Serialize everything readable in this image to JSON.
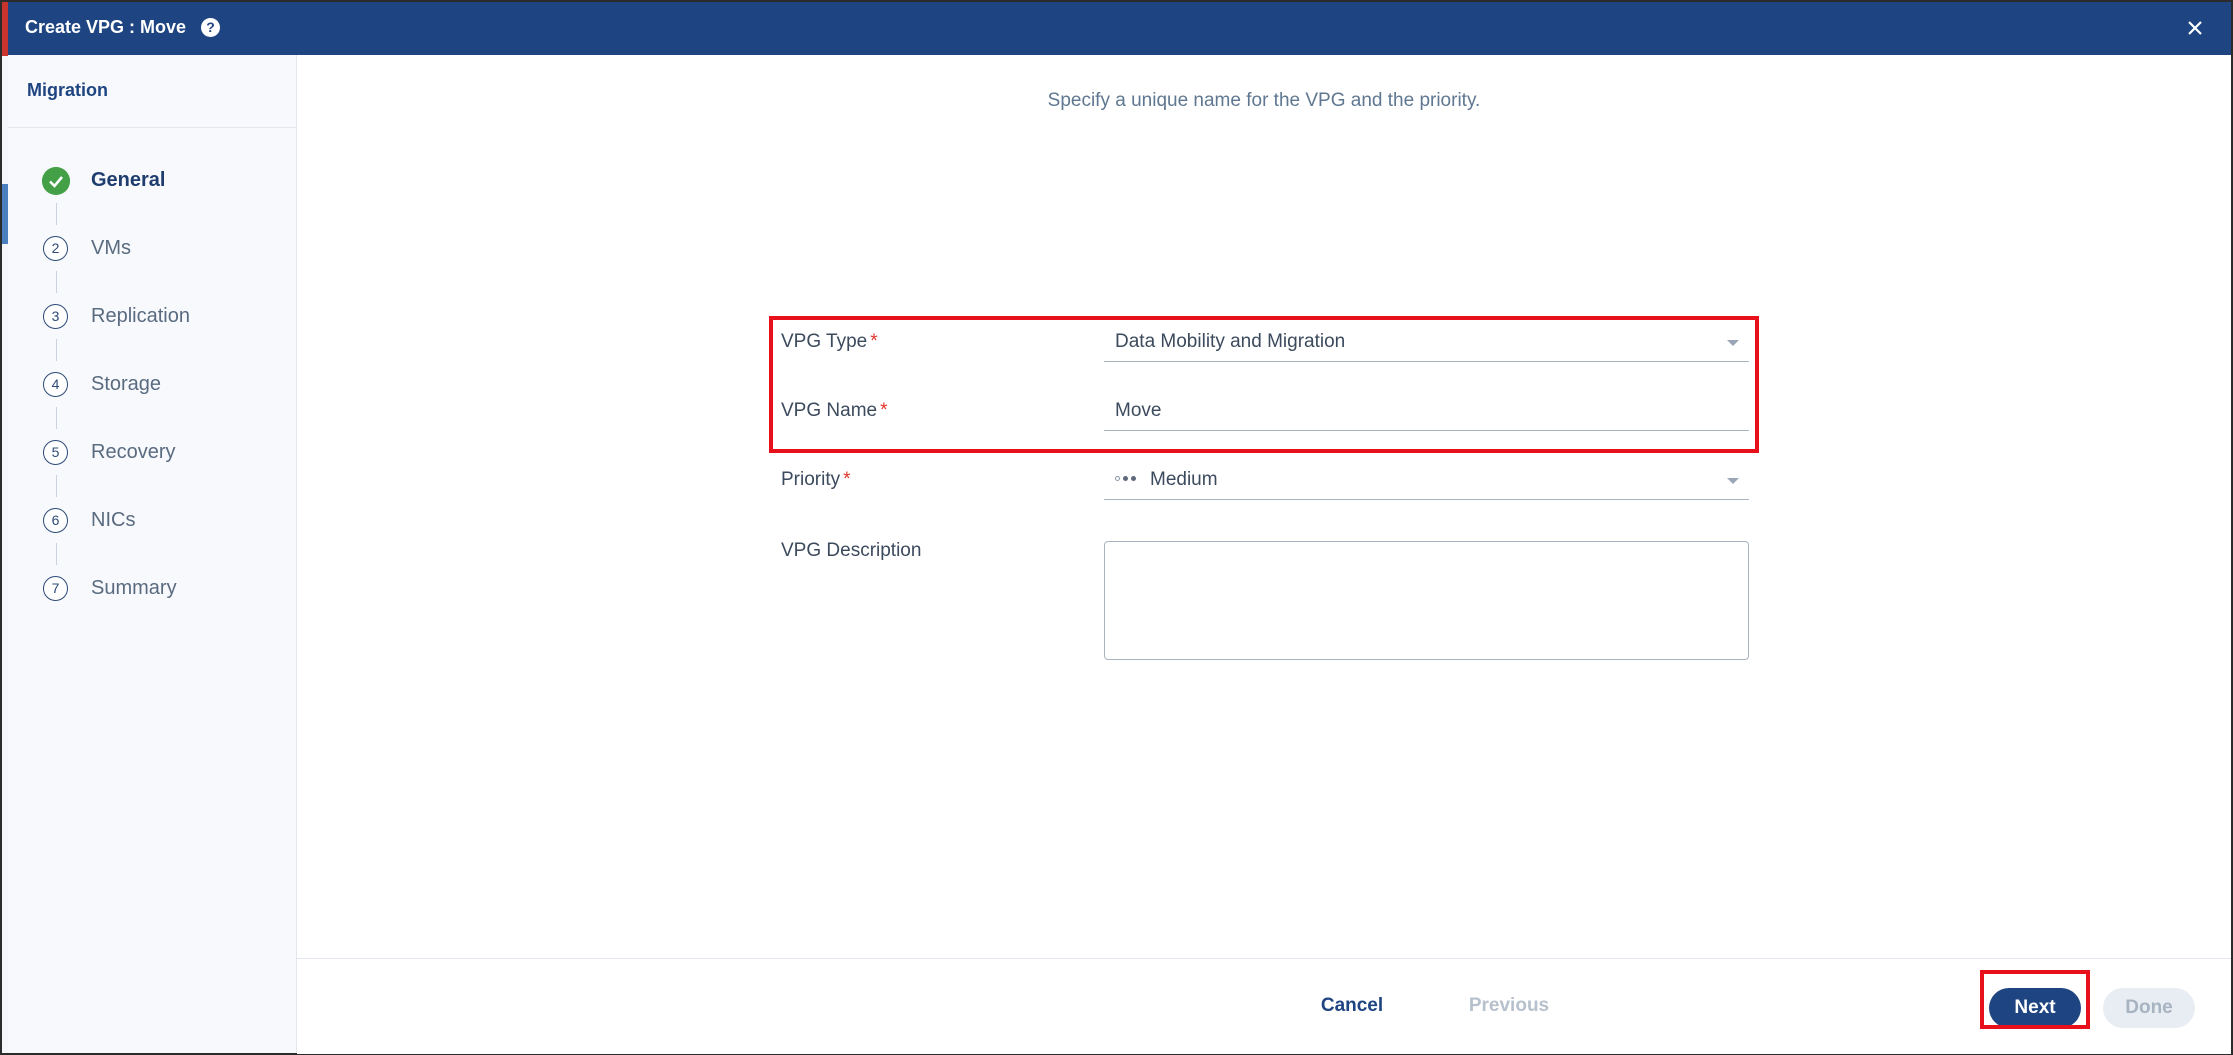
{
  "dialog": {
    "title": "Create VPG : Move",
    "help_icon": "help-icon",
    "help_glyph": "?",
    "close_icon": "close-icon"
  },
  "sidebar": {
    "title": "Migration",
    "steps": [
      {
        "number": "1",
        "label": "General",
        "state": "completed"
      },
      {
        "number": "2",
        "label": "VMs",
        "state": "pending"
      },
      {
        "number": "3",
        "label": "Replication",
        "state": "pending"
      },
      {
        "number": "4",
        "label": "Storage",
        "state": "pending"
      },
      {
        "number": "5",
        "label": "Recovery",
        "state": "pending"
      },
      {
        "number": "6",
        "label": "NICs",
        "state": "pending"
      },
      {
        "number": "7",
        "label": "Summary",
        "state": "pending"
      }
    ]
  },
  "main": {
    "subtitle": "Specify a unique name for the VPG and the priority.",
    "form": {
      "vpg_type": {
        "label": "VPG Type",
        "required_mark": "*",
        "value": "Data Mobility and Migration"
      },
      "vpg_name": {
        "label": "VPG Name",
        "required_mark": "*",
        "value": "Move"
      },
      "priority": {
        "label": "Priority",
        "required_mark": "*",
        "value": "Medium",
        "level": 2,
        "max_level": 3
      },
      "vpg_description": {
        "label": "VPG Description",
        "value": ""
      }
    }
  },
  "footer": {
    "cancel_label": "Cancel",
    "previous_label": "Previous",
    "next_label": "Next",
    "done_label": "Done"
  },
  "colors": {
    "header_bg": "#1e4581",
    "highlight": "#e8101a",
    "completed_step": "#43a047",
    "required": "#e0352b"
  }
}
